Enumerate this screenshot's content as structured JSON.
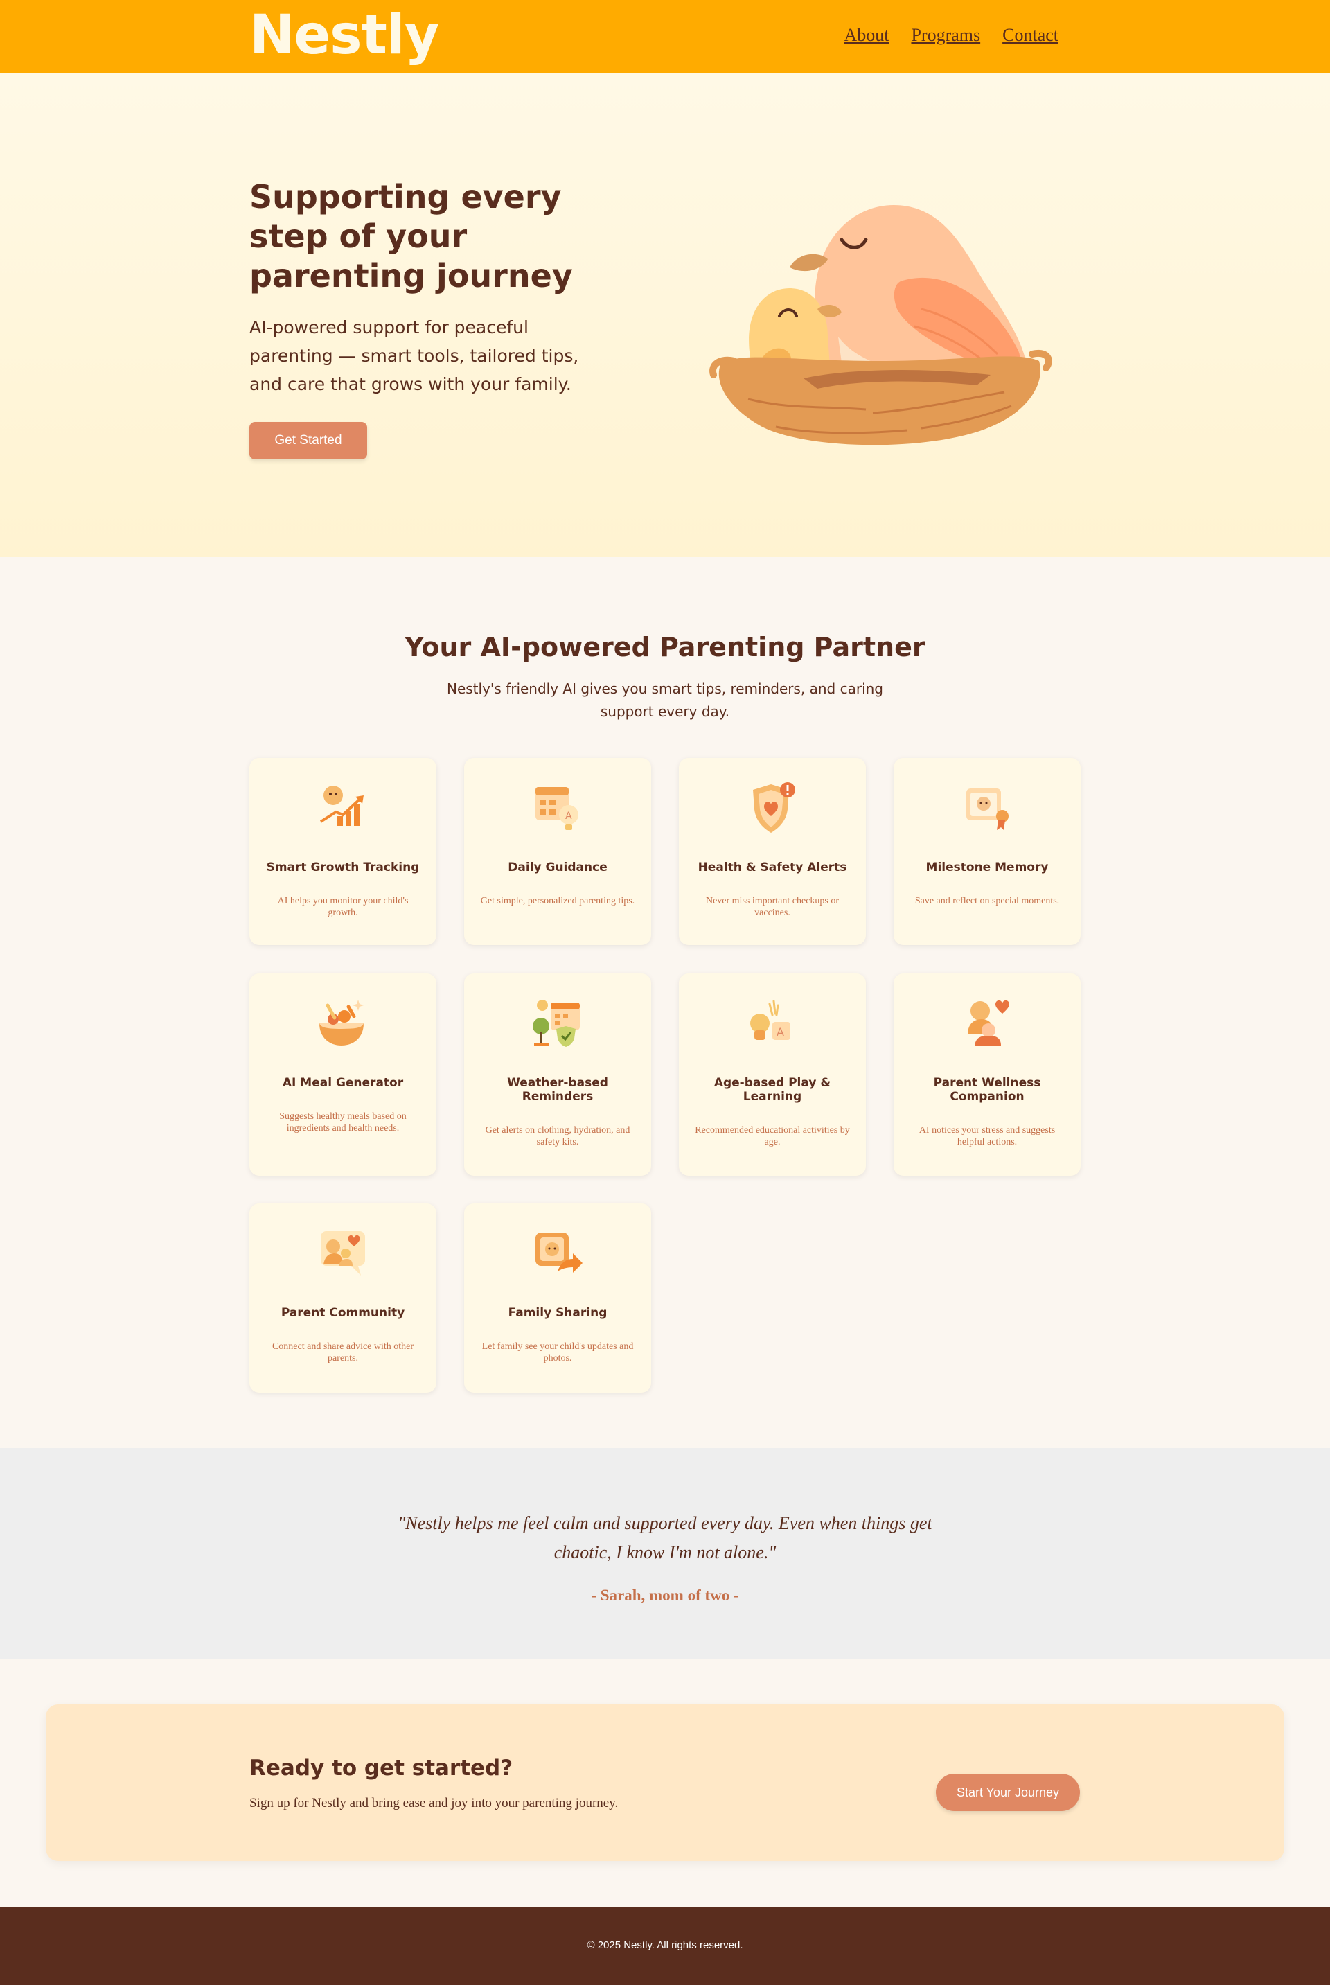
{
  "colors": {
    "header_bg": "#ffab00",
    "accent": "#e08863",
    "text_dark": "#5a2d1e",
    "text_orange": "#c5704a",
    "card_bg": "#fff9e6",
    "cta_bg": "#ffe8c7",
    "footer_bg": "#5a2d1e"
  },
  "header": {
    "logo": "Nestly",
    "nav": [
      "About",
      "Programs",
      "Contact"
    ]
  },
  "hero": {
    "title": "Supporting every step of your parenting journey",
    "subtitle": "AI-powered support for peaceful parenting — smart tools, tailored tips, and care that grows with your family.",
    "button": "Get Started",
    "illustration": "birds-in-nest-illustration"
  },
  "features": {
    "title": "Your AI-powered Parenting Partner",
    "subtitle": "Nestly's friendly AI gives you smart tips, reminders, and caring support every day.",
    "cards": [
      {
        "title": "Smart Growth Tracking",
        "desc": "AI helps you monitor your child's growth.",
        "icon": "growth-chart-icon"
      },
      {
        "title": "Daily Guidance",
        "desc": "Get simple, personalized parenting tips.",
        "icon": "calendar-lightbulb-icon"
      },
      {
        "title": "Health & Safety Alerts",
        "desc": "Never miss important checkups or vaccines.",
        "icon": "shield-heart-icon"
      },
      {
        "title": "Milestone Memory",
        "desc": "Save and reflect on special moments.",
        "icon": "photo-award-icon"
      },
      {
        "title": "AI Meal Generator",
        "desc": "Suggests healthy meals based on ingredients and health needs.",
        "icon": "meal-bowl-icon"
      },
      {
        "title": "Weather-based Reminders",
        "desc": "Get alerts on clothing, hydration, and safety kits.",
        "icon": "weather-calendar-icon"
      },
      {
        "title": "Age-based Play & Learning",
        "desc": "Recommended educational activities by age.",
        "icon": "play-blocks-icon"
      },
      {
        "title": "Parent Wellness Companion",
        "desc": "AI notices your stress and suggests helpful actions.",
        "icon": "parent-heart-icon"
      },
      {
        "title": "Parent Community",
        "desc": "Connect and share advice with other parents.",
        "icon": "community-chat-icon"
      },
      {
        "title": "Family Sharing",
        "desc": "Let family see your child's updates and photos.",
        "icon": "share-photo-icon"
      }
    ]
  },
  "testimonial": {
    "quote": "\"Nestly helps me feel calm and supported every day. Even when things get chaotic, I know I'm not alone.\"",
    "author": "- Sarah, mom of two -"
  },
  "cta": {
    "title": "Ready to get started?",
    "text": "Sign up for Nestly and bring ease and joy into your parenting journey.",
    "button": "Start Your Journey"
  },
  "footer": {
    "copyright": "© 2025 Nestly. All rights reserved."
  }
}
